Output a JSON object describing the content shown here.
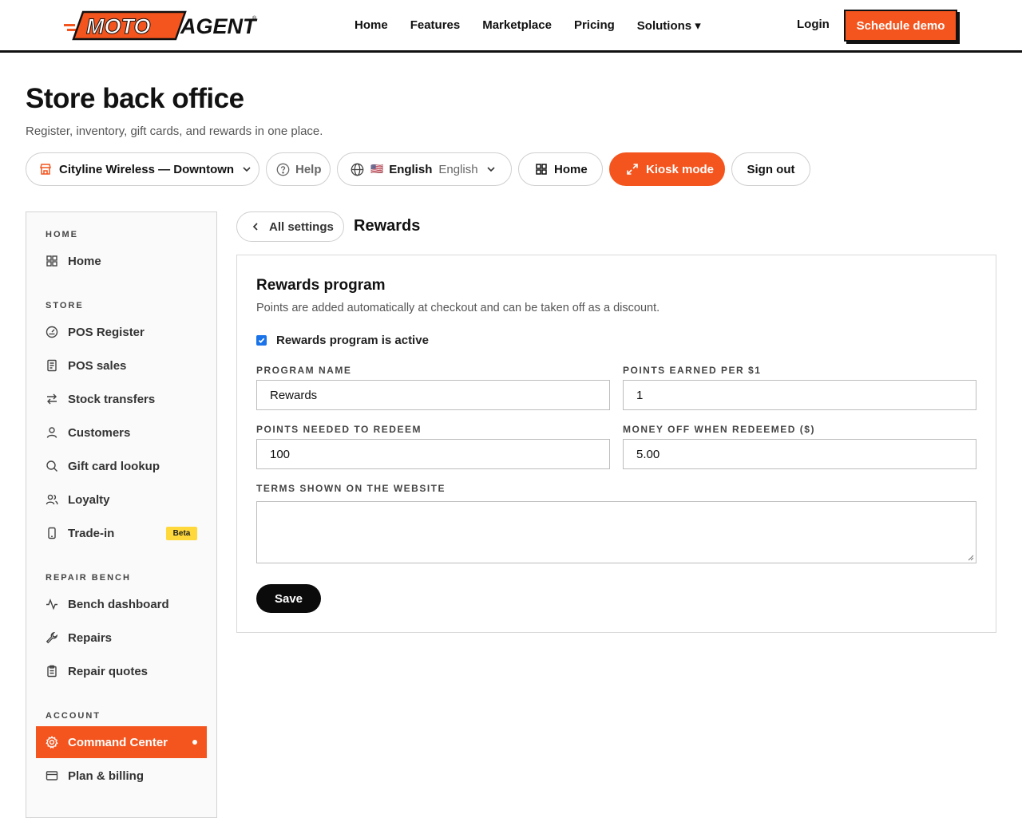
{
  "brand": {
    "logo_text_left": "MOTO",
    "logo_text_right": "AGENT",
    "accent": "#f4541d"
  },
  "topnav": {
    "links": [
      "Home",
      "Features",
      "Marketplace",
      "Pricing",
      "Solutions ▾"
    ],
    "login": "Login",
    "cta": "Schedule demo"
  },
  "header": {
    "title": "Store back office",
    "subtitle": "Register, inventory, gift cards, and rewards in one place."
  },
  "toolbar": {
    "store": "Cityline Wireless — Downtown",
    "help": "Help",
    "language_flag": "🇺🇸",
    "language": "English",
    "language_native": "English",
    "home": "Home",
    "kiosk": "Kiosk mode",
    "signout": "Sign out"
  },
  "sidebar": {
    "sections": [
      {
        "label": "HOME",
        "items": [
          {
            "label": "Home",
            "icon": "grid-icon"
          }
        ]
      },
      {
        "label": "STORE",
        "items": [
          {
            "label": "POS Register",
            "icon": "gauge-icon"
          },
          {
            "label": "POS sales",
            "icon": "receipt-icon"
          },
          {
            "label": "Stock transfers",
            "icon": "transfer-icon"
          },
          {
            "label": "Customers",
            "icon": "user-icon"
          },
          {
            "label": "Gift card lookup",
            "icon": "search-icon"
          },
          {
            "label": "Loyalty",
            "icon": "users-icon"
          },
          {
            "label": "Trade-in",
            "icon": "phone-icon",
            "badge": "Beta"
          }
        ]
      },
      {
        "label": "REPAIR BENCH",
        "items": [
          {
            "label": "Bench dashboard",
            "icon": "activity-icon"
          },
          {
            "label": "Repairs",
            "icon": "wrench-icon"
          },
          {
            "label": "Repair quotes",
            "icon": "clipboard-icon"
          }
        ]
      },
      {
        "label": "ACCOUNT",
        "items": [
          {
            "label": "Command Center",
            "icon": "gear-icon",
            "active": true
          },
          {
            "label": "Plan & billing",
            "icon": "card-icon"
          }
        ]
      }
    ]
  },
  "main": {
    "back": "All settings",
    "section_title": "Rewards",
    "card": {
      "title": "Rewards program",
      "description": "Points are added automatically at checkout and can be taken off as a discount.",
      "active_label": "Rewards program is active",
      "active": true,
      "fields": {
        "program_name": {
          "label": "PROGRAM NAME",
          "value": "Rewards"
        },
        "points_per_dollar": {
          "label": "POINTS EARNED PER $1",
          "value": "1"
        },
        "points_to_redeem": {
          "label": "POINTS NEEDED TO REDEEM",
          "value": "100"
        },
        "money_off": {
          "label": "MONEY OFF WHEN REDEEMED ($)",
          "value": "5.00"
        },
        "terms": {
          "label": "TERMS SHOWN ON THE WEBSITE",
          "value": ""
        }
      },
      "save": "Save"
    }
  }
}
